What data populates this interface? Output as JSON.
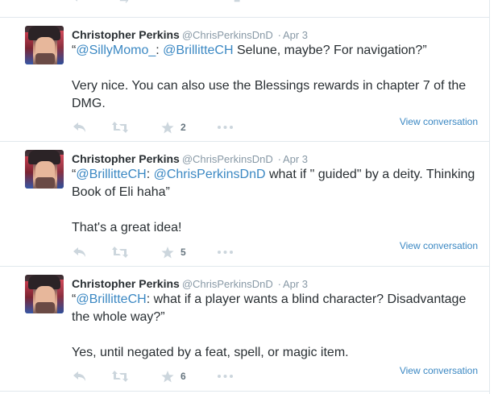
{
  "tweets": [
    {
      "fullname": "Christopher Perkins",
      "username": "@ChrisPerkinsDnD",
      "separator": "·",
      "time": "Apr 3",
      "quote": {
        "open": "“",
        "mention1": "@SillyMomo_",
        "mid1": ": ",
        "mention2": "@BrillitteCH",
        "rest": " Selune, maybe? For navigation?”"
      },
      "reply": "Very nice. You can also use the Blessings rewards in chapter 7 of the DMG.",
      "favorite_count": "2",
      "view_conversation": "View conversation"
    },
    {
      "fullname": "Christopher Perkins",
      "username": "@ChrisPerkinsDnD",
      "separator": "·",
      "time": "Apr 3",
      "quote": {
        "open": "“",
        "mention1": "@BrillitteCH",
        "mid1": ": ",
        "mention2": "@ChrisPerkinsDnD",
        "rest": " what if \" guided\" by a deity. Thinking Book of Eli haha”"
      },
      "reply": "That's a great idea!",
      "favorite_count": "5",
      "view_conversation": "View conversation"
    },
    {
      "fullname": "Christopher Perkins",
      "username": "@ChrisPerkinsDnD",
      "separator": "·",
      "time": "Apr 3",
      "quote": {
        "open": "“",
        "mention1": "@BrillitteCH",
        "rest": ": what if a player wants a blind character? Disadvantage the whole way?”"
      },
      "reply": "Yes, until negated by a feat, spell, or magic item.",
      "favorite_count": "6",
      "view_conversation": "View conversation"
    }
  ],
  "icons": {
    "reply": "reply-icon",
    "retweet": "retweet-icon",
    "favorite": "star-icon",
    "more": "more-icon"
  },
  "colors": {
    "link": "#3b88c3",
    "text": "#292f33",
    "muted": "#8899a6",
    "icon": "#ccd6dd",
    "divider": "#e1e8ed"
  }
}
